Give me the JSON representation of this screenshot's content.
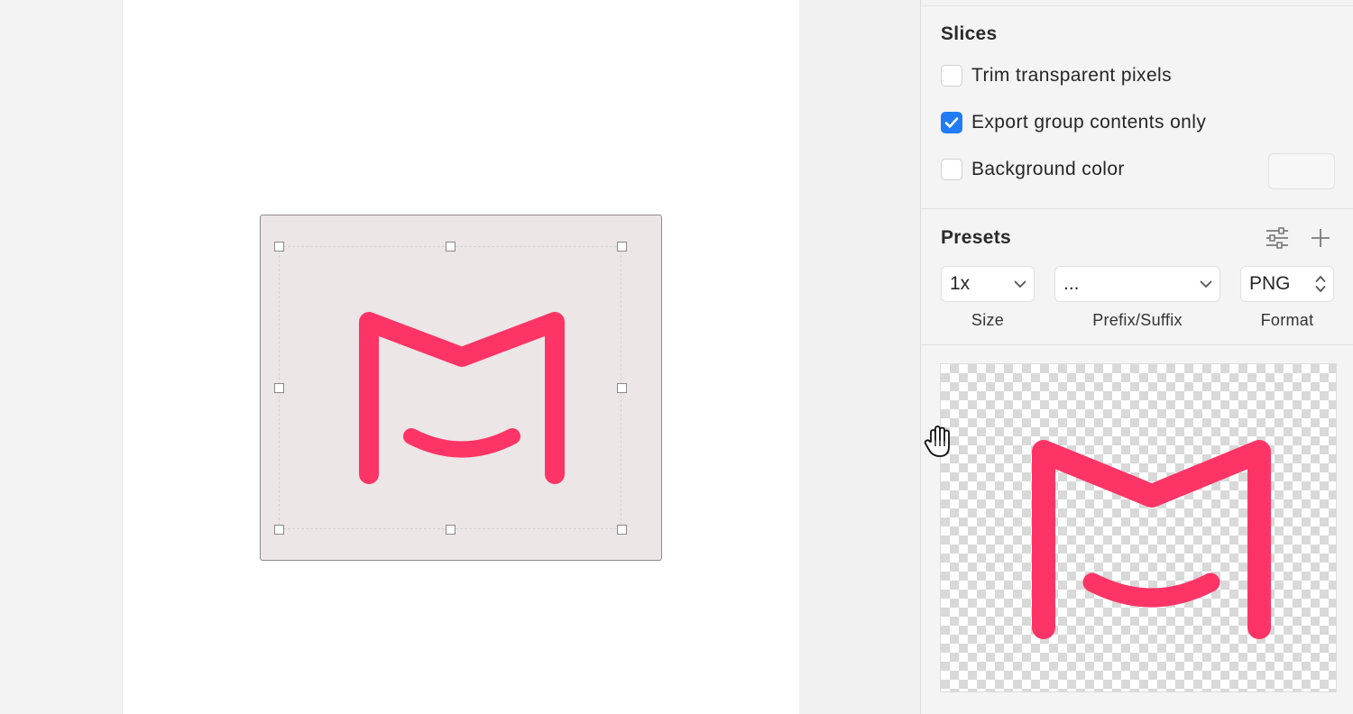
{
  "inspector": {
    "slices": {
      "title": "Slices",
      "options": [
        {
          "label": "Trim transparent pixels",
          "checked": false
        },
        {
          "label": "Export group contents only",
          "checked": true
        },
        {
          "label": "Background color",
          "checked": false
        }
      ]
    },
    "presets": {
      "title": "Presets",
      "size": {
        "value": "1x",
        "label": "Size"
      },
      "prefix_suffix": {
        "value": "...",
        "label": "Prefix/Suffix"
      },
      "format": {
        "value": "PNG",
        "label": "Format"
      }
    }
  },
  "colors": {
    "accent_checkbox": "#1f7cf5",
    "logo_pink": "#ff3466",
    "selection_fill": "#ece6e6"
  },
  "icons": [
    "preset-settings-icon",
    "add-preset-icon",
    "chevron-down-icon",
    "stepper-arrows-icon",
    "hand-cursor-icon",
    "checkmark-icon"
  ]
}
